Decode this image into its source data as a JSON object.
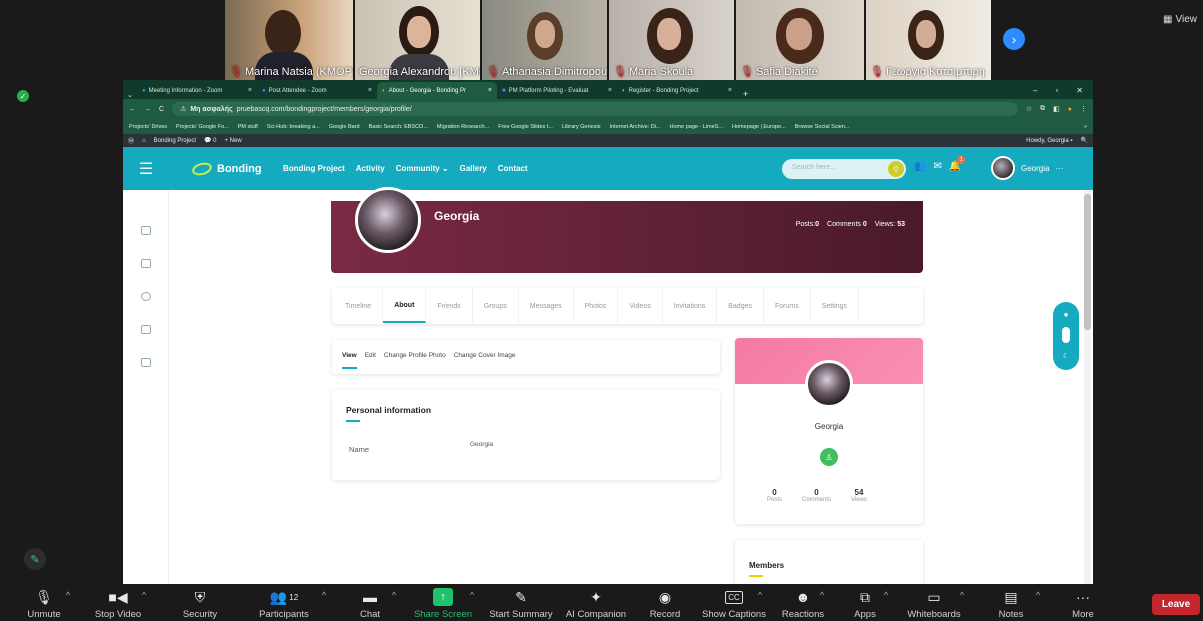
{
  "zoom": {
    "view_label": "View",
    "participants_strip": [
      {
        "name": "Marina Natsia (KMOP)",
        "muted": true
      },
      {
        "name": "Georgia Alexandrou [KMO...",
        "muted": false
      },
      {
        "name": "Athanasia Dimitropoul...",
        "muted": true
      },
      {
        "name": "Maria Skoula",
        "muted": true
      },
      {
        "name": "Safia Diakité",
        "muted": true
      },
      {
        "name": "Γεωργια Κατσιμπιρη",
        "muted": true
      }
    ],
    "toolbar": {
      "unmute": "Unmute",
      "stop_video": "Stop Video",
      "security": "Security",
      "participants": "Participants",
      "participants_count": "12",
      "chat": "Chat",
      "share_screen": "Share Screen",
      "start_summary": "Start Summary",
      "ai_companion": "AI Companion",
      "record": "Record",
      "show_captions": "Show Captions",
      "reactions": "Reactions",
      "apps": "Apps",
      "whiteboards": "Whiteboards",
      "notes": "Notes",
      "more": "More",
      "leave": "Leave",
      "cc": "CC"
    }
  },
  "browser": {
    "tabs": [
      {
        "label": "Meeting Information - Zoom",
        "active": false
      },
      {
        "label": "Post Attendee - Zoom",
        "active": false
      },
      {
        "label": "About - Georgia - Bonding Pr",
        "active": true
      },
      {
        "label": "PM Platform Piloting - Evaluat",
        "active": false
      },
      {
        "label": "Register - Bonding Project",
        "active": false
      }
    ],
    "not_secure": "Μη ασφαλής",
    "url": "pruebascq.com/bondingproject/members/georgia/profile/",
    "bookmarks": [
      "Projects' Drives",
      "Projects' Google Fo...",
      "PM stuff",
      "Sci-Hub: breaking a...",
      "Google Bard",
      "Basic Search: EBSCO...",
      "Migration Research...",
      "Free Google Slides t...",
      "Library Genesis",
      "Internet Archive: Di...",
      "Home page - LimeS...",
      "Homepage | Europe...",
      "Browse Social Scien..."
    ],
    "bookmarks_more": "»"
  },
  "wp_admin_bar": {
    "site_name": "Bonding Project",
    "comments_count": "0",
    "new_label": "New",
    "howdy": "Howdy, Georgia"
  },
  "site": {
    "logo": "Bonding",
    "nav": [
      "Bonding Project",
      "Activity",
      "Community",
      "Gallery",
      "Contact"
    ],
    "search_placeholder": "Search here...",
    "notification_badge": "1",
    "user_name": "Georgia",
    "user_menu": "···"
  },
  "profile": {
    "name": "Georgia",
    "posts_label": "Posts:",
    "posts": "0",
    "comments_label": "Comments",
    "comments": "0",
    "views_label": "Views:",
    "views": "53",
    "tabs": [
      "Timeline",
      "About",
      "Friends",
      "Groups",
      "Messages",
      "Photos",
      "Videos",
      "Invitations",
      "Badges",
      "Forums",
      "Settings"
    ],
    "active_tab": "About",
    "subtabs": [
      "View",
      "Edit",
      "Change Profile Photo",
      "Change Cover Image"
    ],
    "section_title": "Personal information",
    "field_label": "Name",
    "field_value": "Georgia"
  },
  "side_card": {
    "name": "Georgia",
    "posts": "0",
    "posts_label": "Posts",
    "comments": "0",
    "comments_label": "Comments",
    "views": "54",
    "views_label": "Views",
    "members_title": "Members"
  },
  "colors": {
    "site_header": "#15aabf",
    "browser_chrome": "#1f5a43",
    "cover": "#6b1f37",
    "leave": "#c4262e",
    "share": "#1fc26b"
  }
}
